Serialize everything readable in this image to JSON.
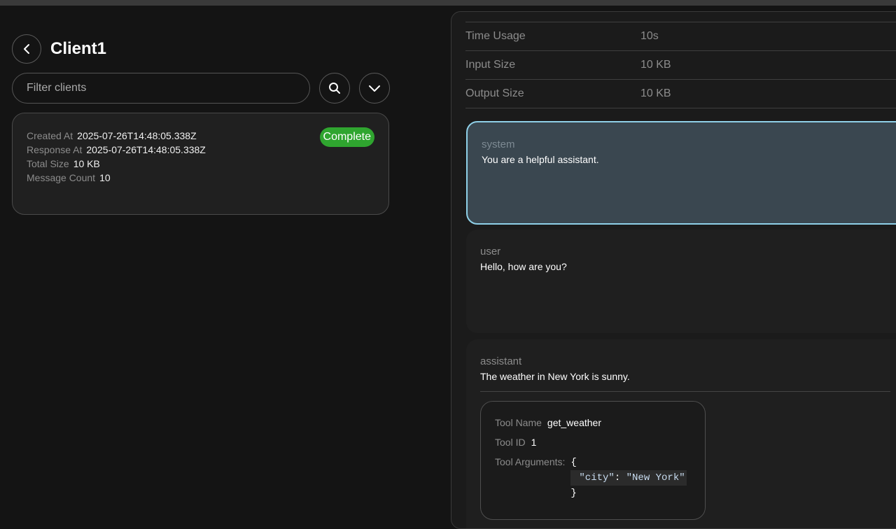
{
  "header": {
    "title": "Client1"
  },
  "filter": {
    "placeholder": "Filter clients"
  },
  "client_card": {
    "status": "Complete",
    "status_color": "#2fa52f",
    "fields": [
      {
        "label": "Created At",
        "value": "2025-07-26T14:48:05.338Z"
      },
      {
        "label": "Response At",
        "value": "2025-07-26T14:48:05.338Z"
      },
      {
        "label": "Total Size",
        "value": "10 KB"
      },
      {
        "label": "Message Count",
        "value": "10"
      }
    ]
  },
  "stats": [
    {
      "label": "Time Usage",
      "value": "10s"
    },
    {
      "label": "Input Size",
      "value": "10 KB"
    },
    {
      "label": "Output Size",
      "value": "10 KB"
    }
  ],
  "messages": [
    {
      "role": "system",
      "content": "You are a helpful assistant."
    },
    {
      "role": "user",
      "content": "Hello, how are you?"
    },
    {
      "role": "assistant",
      "content": "The weather in New York is sunny."
    }
  ],
  "tool_call": {
    "name_label": "Tool Name",
    "name": "get_weather",
    "id_label": "Tool ID",
    "id": "1",
    "args_label": "Tool Arguments:",
    "args_open": "{",
    "args_key": "\"city\"",
    "args_sep": ": ",
    "args_value": "\"New York\"",
    "args_close": "}"
  },
  "icons": {
    "back": "chevron-left-icon",
    "search": "search-icon",
    "expand": "chevron-down-icon"
  },
  "colors": {
    "system_border": "#8fd0e8",
    "system_bg": "#3a4750",
    "status": "#2fa52f"
  }
}
